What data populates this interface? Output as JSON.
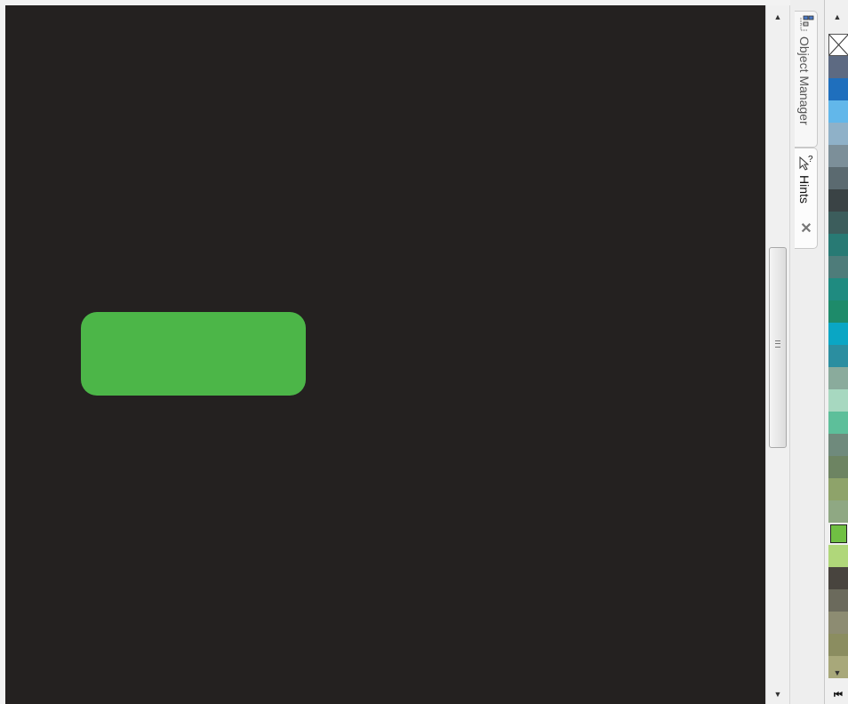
{
  "canvas": {
    "background": "#242120",
    "shape_fill": "#4cb648"
  },
  "scrollbar": {
    "up_arrow": "▲",
    "down_arrow": "▼"
  },
  "dockers": {
    "object_manager_label": "Object Manager",
    "hints_label": "Hints",
    "close_glyph": "✕"
  },
  "palette": {
    "up_arrow": "▲",
    "down_arrow": "▼",
    "first_glyph": "⏮",
    "colors": [
      "#5d6a82",
      "#1f6fbd",
      "#62b7ea",
      "#8fb1c8",
      "#7c8f99",
      "#5b6a70",
      "#3a4345",
      "#3c5d5c",
      "#287a74",
      "#4e7c7a",
      "#1f8b80",
      "#1e8b6a",
      "#0aa6c4",
      "#2b8ea0",
      "#8aab9c",
      "#a7d8c0",
      "#5dbf9a",
      "#6f8a7c",
      "#6d8462",
      "#8ea36a",
      "#8fa883",
      "#70c043",
      "#b0d77a",
      "#48443e",
      "#6b6a5c",
      "#8d8c72",
      "#8b8d60",
      "#a8a87a"
    ],
    "selected_index": 21
  }
}
